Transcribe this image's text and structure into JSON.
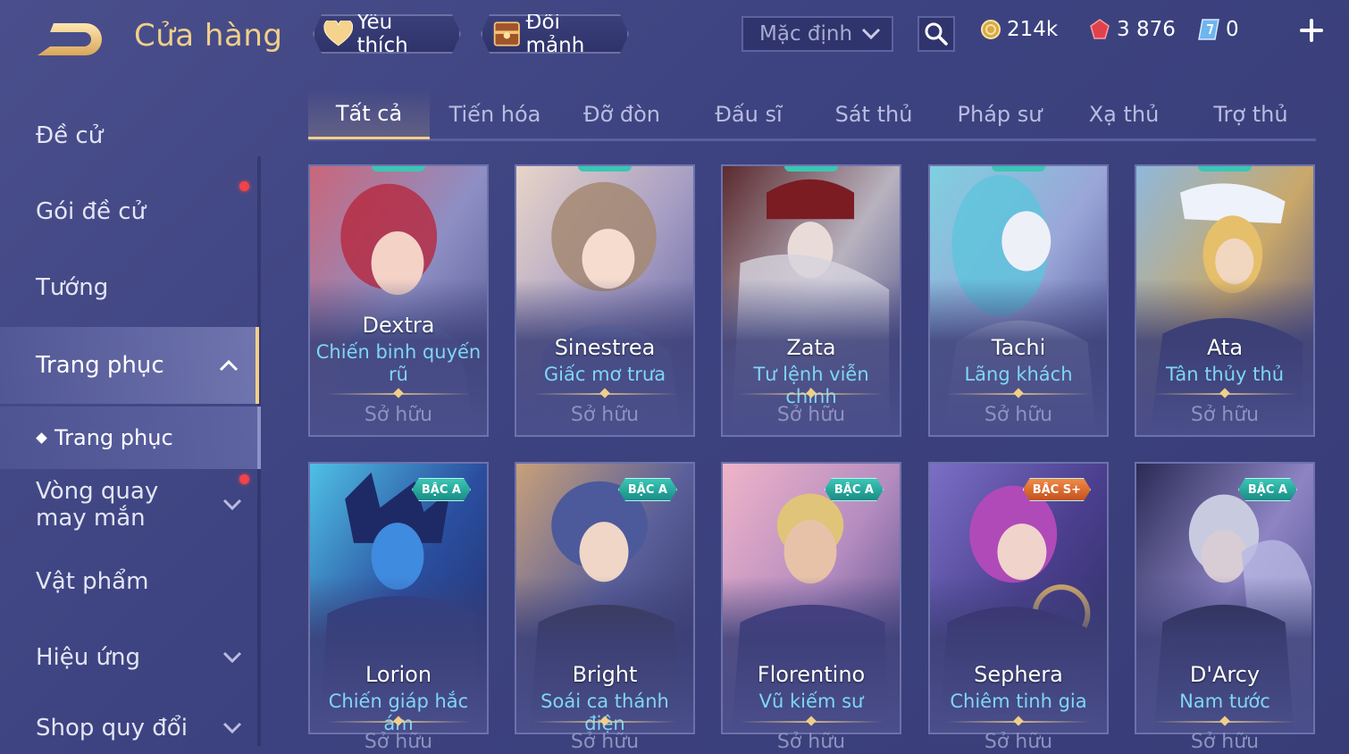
{
  "header": {
    "title": "Cửa hàng",
    "favorites_label": "Yêu thích",
    "exchange_label": "Đổi mảnh",
    "sort_value": "Mặc định",
    "currencies": [
      {
        "icon": "gold-coin-icon",
        "value": "214k"
      },
      {
        "icon": "ruby-icon",
        "value": "3 876"
      },
      {
        "icon": "voucher-icon",
        "value": "0"
      }
    ]
  },
  "sidebar": {
    "items": [
      {
        "label": "Đề cử"
      },
      {
        "label": "Gói đề cử"
      },
      {
        "label": "Tướng"
      },
      {
        "label": "Trang phục"
      },
      {
        "label": "Trang phục"
      },
      {
        "label": "Vòng quay may mắn"
      },
      {
        "label": "Vật phẩm"
      },
      {
        "label": "Hiệu ứng"
      },
      {
        "label": "Shop quy đổi"
      }
    ]
  },
  "tabs": [
    "Tất cả",
    "Tiến hóa",
    "Đỡ đòn",
    "Đấu sĩ",
    "Sát thủ",
    "Pháp sư",
    "Xạ thủ",
    "Trợ thủ"
  ],
  "cards": [
    {
      "hero": "Dextra",
      "skin": "Chiến binh quyến rũ",
      "status": "Sở hữu",
      "badge": ""
    },
    {
      "hero": "Sinestrea",
      "skin": "Giấc mơ trưa",
      "status": "Sở hữu",
      "badge": ""
    },
    {
      "hero": "Zata",
      "skin": "Tư lệnh viễn chinh",
      "status": "Sở hữu",
      "badge": ""
    },
    {
      "hero": "Tachi",
      "skin": "Lãng khách",
      "status": "Sở hữu",
      "badge": ""
    },
    {
      "hero": "Ata",
      "skin": "Tân thủy thủ",
      "status": "Sở hữu",
      "badge": ""
    },
    {
      "hero": "Lorion",
      "skin": "Chiến giáp hắc ám",
      "status": "Sở hữu",
      "badge": "BẬC A"
    },
    {
      "hero": "Bright",
      "skin": "Soái ca thánh điện",
      "status": "Sở hữu",
      "badge": "BẬC A"
    },
    {
      "hero": "Florentino",
      "skin": "Vũ kiếm sư",
      "status": "Sở hữu",
      "badge": "BẬC A"
    },
    {
      "hero": "Sephera",
      "skin": "Chiêm tinh gia",
      "status": "Sở hữu",
      "badge": "BẬC S+"
    },
    {
      "hero": "D'Arcy",
      "skin": "Nam tước",
      "status": "Sở hữu",
      "badge": "BẬC A"
    }
  ],
  "colors": {
    "accent_gold": "#f0cf8a",
    "skin_text": "#7fd6f4",
    "badge_a": "#3bc6b5",
    "badge_splus": "#f08a46",
    "notification": "#f0434a"
  }
}
